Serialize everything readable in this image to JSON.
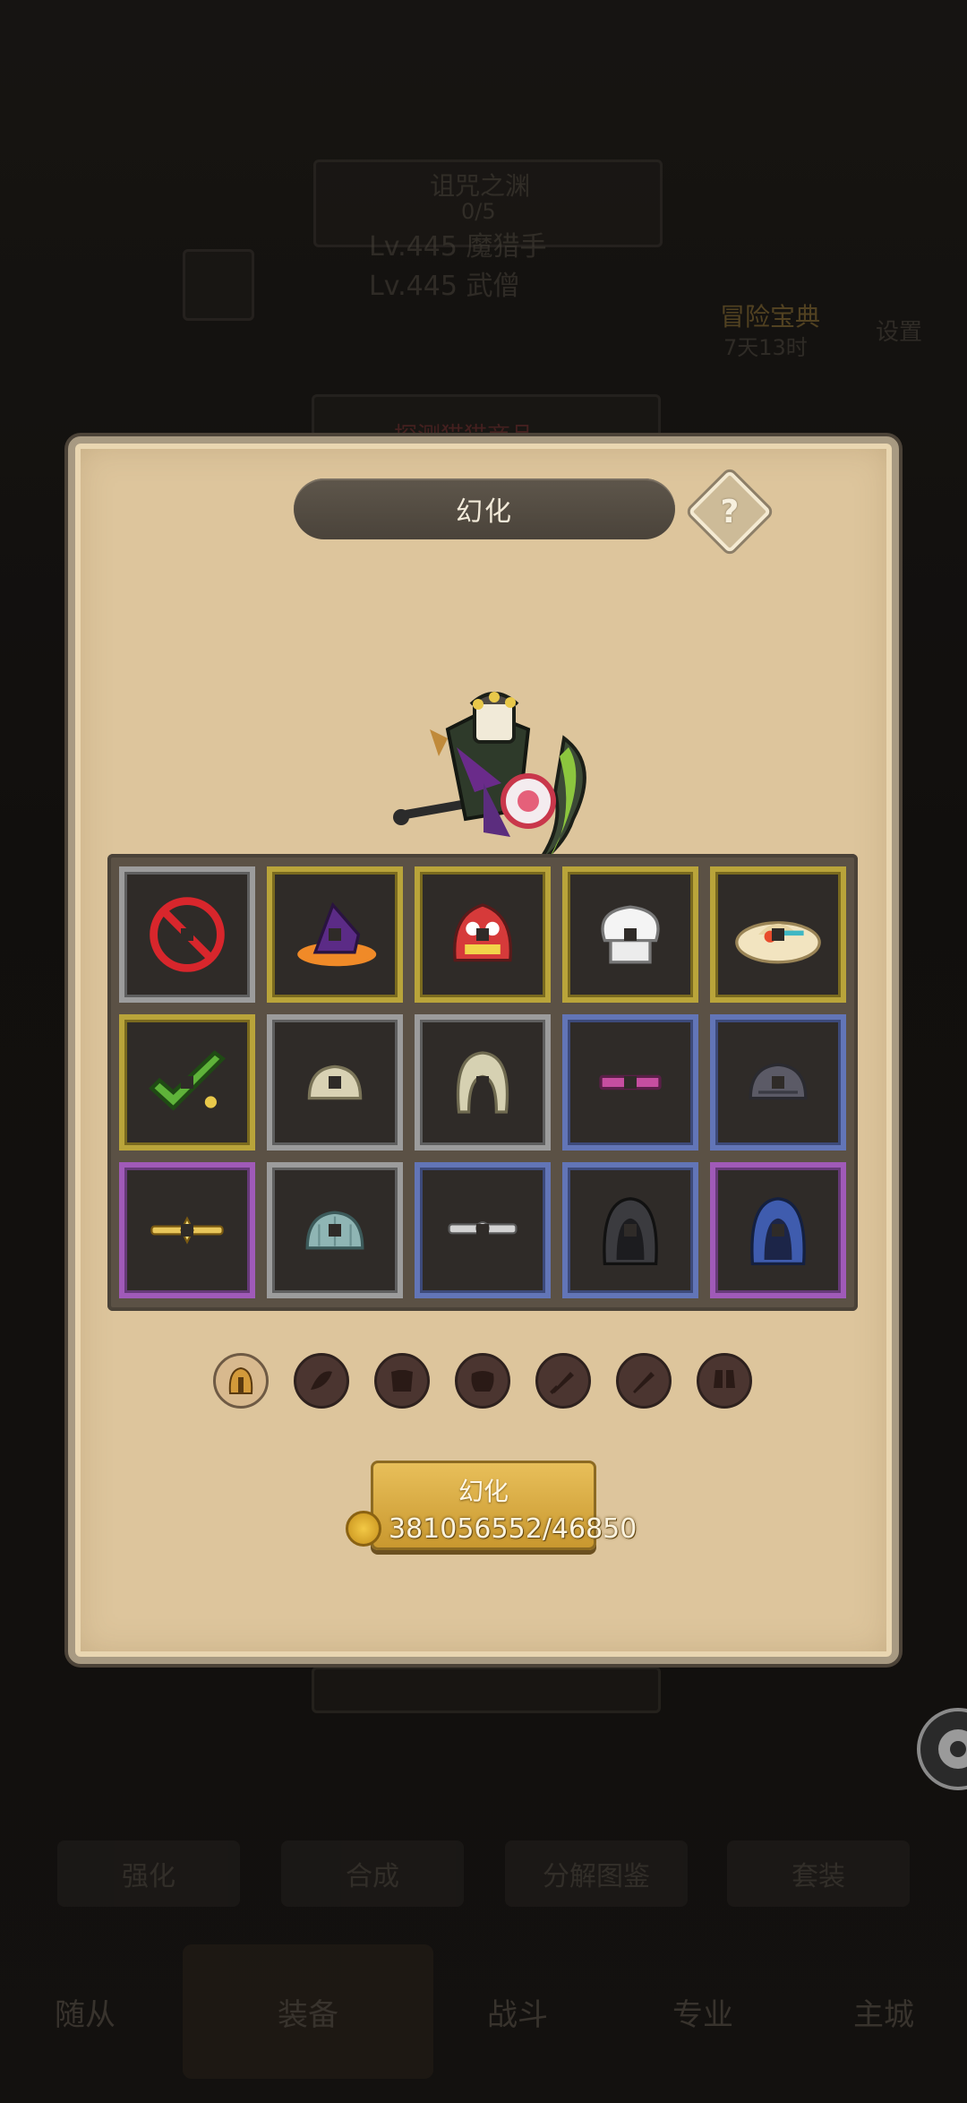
{
  "background": {
    "area_title": "诅咒之渊",
    "area_progress": "0/5",
    "player_line_1": "Lv.445 魔猎手",
    "player_line_2": "Lv.445 武僧",
    "event_label": "冒险宝典",
    "event_timer": "7天13时",
    "settings_label": "设置",
    "banner_text": "探测猫猫商品",
    "tabs": [
      "强化",
      "合成",
      "分解图鉴",
      "套装"
    ],
    "nav": [
      "随从",
      "装备",
      "战斗",
      "专业",
      "主城"
    ]
  },
  "modal": {
    "title": "幻化",
    "help_glyph": "?",
    "categories": [
      {
        "icon": "helmet-icon"
      },
      {
        "icon": "cloak-icon"
      },
      {
        "icon": "armor-icon"
      },
      {
        "icon": "pants-icon"
      },
      {
        "icon": "sword-icon"
      },
      {
        "icon": "offhand-icon"
      },
      {
        "icon": "boots-icon"
      }
    ],
    "grid": [
      {
        "icon": "none-icon",
        "rarity": "grey"
      },
      {
        "icon": "witch-hat-icon",
        "rarity": "gold"
      },
      {
        "icon": "lion-hat-icon",
        "rarity": "gold"
      },
      {
        "icon": "chef-hat-icon",
        "rarity": "gold"
      },
      {
        "icon": "straw-hat-icon",
        "rarity": "gold"
      },
      {
        "icon": "check-selected-icon",
        "rarity": "gold"
      },
      {
        "icon": "cloth-cap-icon",
        "rarity": "grey"
      },
      {
        "icon": "hood-icon",
        "rarity": "grey"
      },
      {
        "icon": "headband-icon",
        "rarity": "blue"
      },
      {
        "icon": "dark-cap-icon",
        "rarity": "blue"
      },
      {
        "icon": "gold-circlet-icon",
        "rarity": "purple"
      },
      {
        "icon": "teal-cap-icon",
        "rarity": "grey"
      },
      {
        "icon": "silver-circlet-icon",
        "rarity": "blue"
      },
      {
        "icon": "black-helm-icon",
        "rarity": "blue"
      },
      {
        "icon": "blue-helm-icon",
        "rarity": "purple"
      }
    ],
    "action_label": "幻化",
    "cost_text": "381056552/46850",
    "colors": {
      "panel": "#ddc59c",
      "button": "#d9ab40",
      "grey": "#9c9c9c",
      "gold": "#b9a43a",
      "blue": "#6275b7",
      "purple": "#a05ab8"
    }
  }
}
